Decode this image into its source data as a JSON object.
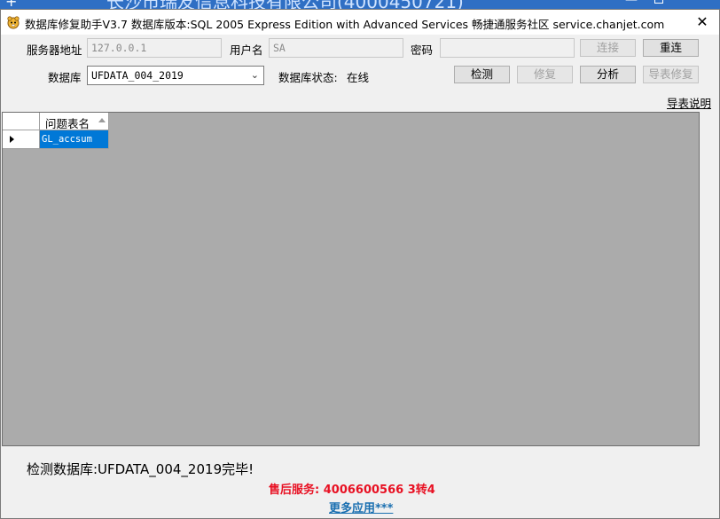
{
  "background_window": {
    "title": "长沙市瑞友信息科技有限公司(4000450721)"
  },
  "window": {
    "title": "数据库修复助手V3.7 数据库版本:SQL 2005 Express Edition with Advanced Services  畅捷通服务社区 service.chanjet.com",
    "close_label": "✕"
  },
  "connection": {
    "server_label": "服务器地址",
    "server_value": "127.0.0.1",
    "user_label": "用户名",
    "user_value": "SA",
    "password_label": "密码",
    "password_value": "",
    "connect_label": "连接",
    "reconnect_label": "重连"
  },
  "database": {
    "label": "数据库",
    "selected": "UFDATA_004_2019",
    "status_label": "数据库状态:",
    "status_value": "在线",
    "check_label": "检测",
    "repair_label": "修复",
    "analyze_label": "分析",
    "import_repair_label": "导表修复",
    "import_help_link": "导表说明"
  },
  "grid": {
    "column_header": "问题表名",
    "rows": [
      "GL_accsum"
    ]
  },
  "footer": {
    "status_message": "检测数据库:UFDATA_004_2019完毕!",
    "support_text": "售后服务: 4006600566 3转4",
    "more_apps_link": "更多应用***"
  },
  "colors": {
    "selection": "#0078d7",
    "support_red": "#e81123",
    "link_blue": "#1a6fb0",
    "grid_bg": "#ababab"
  }
}
